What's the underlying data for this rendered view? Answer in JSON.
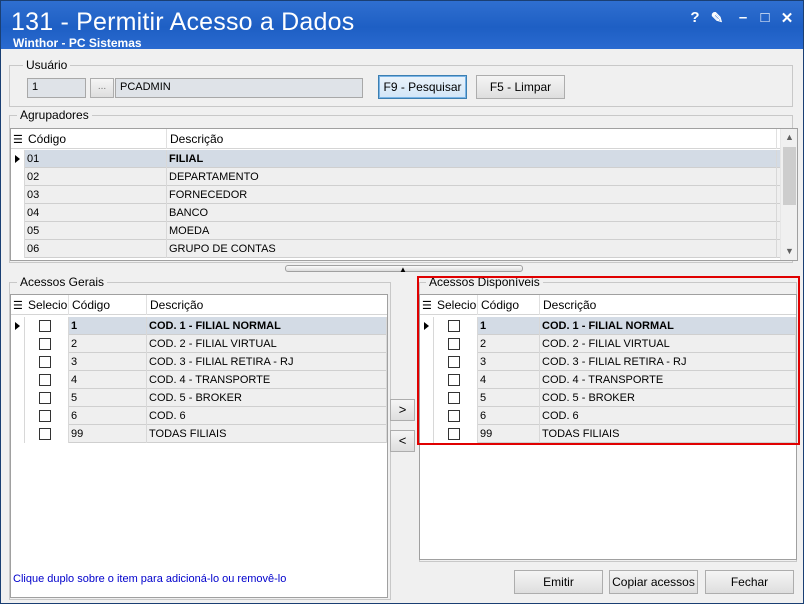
{
  "window": {
    "title": "131 - Permitir Acesso a Dados",
    "subtitle": "Winthor - PC Sistemas",
    "controls": [
      "?",
      "✎",
      "–",
      "□",
      "✕"
    ]
  },
  "usuario": {
    "group_label": "Usuário",
    "code": "1",
    "browse_label": "...",
    "name": "PCADMIN",
    "search_button": "F9 - Pesquisar",
    "clear_button": "F5 - Limpar"
  },
  "agrupadores": {
    "group_label": "Agrupadores",
    "columns": [
      "Código",
      "Descrição"
    ],
    "rows": [
      {
        "code": "01",
        "desc": "FILIAL"
      },
      {
        "code": "02",
        "desc": "DEPARTAMENTO"
      },
      {
        "code": "03",
        "desc": "FORNECEDOR"
      },
      {
        "code": "04",
        "desc": "BANCO"
      },
      {
        "code": "05",
        "desc": "MOEDA"
      },
      {
        "code": "06",
        "desc": "GRUPO DE CONTAS"
      }
    ]
  },
  "acessos_gerais": {
    "group_label": "Acessos Gerais",
    "columns": [
      "Selecio",
      "Código",
      "Descrição"
    ],
    "rows": [
      {
        "code": "1",
        "desc": "COD. 1 - FILIAL NORMAL"
      },
      {
        "code": "2",
        "desc": "COD. 2 - FILIAL VIRTUAL"
      },
      {
        "code": "3",
        "desc": "COD. 3 - FILIAL RETIRA - RJ"
      },
      {
        "code": "4",
        "desc": "COD. 4 - TRANSPORTE"
      },
      {
        "code": "5",
        "desc": "COD. 5 - BROKER"
      },
      {
        "code": "6",
        "desc": "COD. 6"
      },
      {
        "code": "99",
        "desc": "TODAS FILIAIS"
      }
    ]
  },
  "acessos_disponiveis": {
    "group_label": "Acessos Disponíveis",
    "columns": [
      "Selecio",
      "Código",
      "Descrição"
    ],
    "rows": [
      {
        "code": "1",
        "desc": "COD. 1 - FILIAL NORMAL"
      },
      {
        "code": "2",
        "desc": "COD. 2 - FILIAL VIRTUAL"
      },
      {
        "code": "3",
        "desc": "COD. 3 - FILIAL RETIRA - RJ"
      },
      {
        "code": "4",
        "desc": "COD. 4 - TRANSPORTE"
      },
      {
        "code": "5",
        "desc": "COD. 5 - BROKER"
      },
      {
        "code": "6",
        "desc": "COD. 6"
      },
      {
        "code": "99",
        "desc": "TODAS FILIAIS"
      }
    ]
  },
  "move": {
    "add": ">",
    "remove": "<"
  },
  "hint": "Clique duplo sobre o item para adicioná-lo ou removê-lo",
  "footer": {
    "emitir": "Emitir",
    "copiar": "Copiar acessos",
    "fechar": "Fechar"
  },
  "colors": {
    "titlebar": "#1e5fc4",
    "highlight": "#e00000",
    "hint": "#0000cc"
  }
}
